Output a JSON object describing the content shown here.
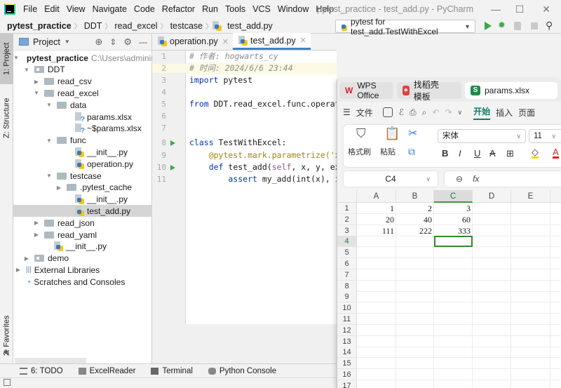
{
  "titlebar": {
    "menu": [
      "File",
      "Edit",
      "View",
      "Navigate",
      "Code",
      "Refactor",
      "Run",
      "Tools",
      "VCS",
      "Window",
      "Help"
    ],
    "window_title": "pytest_practice - test_add.py - PyCharm",
    "minimize": "—",
    "maximize": "☐",
    "close": "✕"
  },
  "navbar": {
    "breadcrumbs": [
      "pytest_practice",
      "DDT",
      "read_excel",
      "testcase",
      "test_add.py"
    ],
    "run_config": "pytest for test_add.TestWithExcel"
  },
  "leftstrip": {
    "project_tab": "1: Project",
    "structure_tab": "Z: Structure",
    "favorites_tab": "2: Favorites"
  },
  "project": {
    "header": "Project",
    "root_path": "C:\\Users\\administe",
    "tree": [
      {
        "label": "pytest_practice",
        "type": "folder",
        "depth": 0,
        "expanded": true
      },
      {
        "label": "DDT",
        "type": "folder",
        "depth": 1,
        "expanded": true
      },
      {
        "label": "read_csv",
        "type": "folder",
        "depth": 2,
        "expanded": false
      },
      {
        "label": "read_excel",
        "type": "folder",
        "depth": 2,
        "expanded": true
      },
      {
        "label": "data",
        "type": "folder",
        "depth": 3,
        "expanded": true
      },
      {
        "label": "params.xlsx",
        "type": "unknown",
        "depth": 4
      },
      {
        "label": "~$params.xlsx",
        "type": "unknown",
        "depth": 4
      },
      {
        "label": "func",
        "type": "folder",
        "depth": 3,
        "expanded": true
      },
      {
        "label": "__init__.py",
        "type": "py",
        "depth": 4
      },
      {
        "label": "operation.py",
        "type": "py",
        "depth": 4
      },
      {
        "label": "testcase",
        "type": "folder",
        "depth": 3,
        "expanded": true
      },
      {
        "label": ".pytest_cache",
        "type": "folder",
        "depth": 4,
        "expanded": false
      },
      {
        "label": "__init__.py",
        "type": "py",
        "depth": 4
      },
      {
        "label": "test_add.py",
        "type": "py",
        "depth": 4,
        "selected": true
      },
      {
        "label": "read_json",
        "type": "folder",
        "depth": 2,
        "expanded": false
      },
      {
        "label": "read_yaml",
        "type": "folder",
        "depth": 2,
        "expanded": false
      },
      {
        "label": "__init__.py",
        "type": "py",
        "depth": 2
      },
      {
        "label": "demo",
        "type": "folder",
        "depth": 1,
        "expanded": false
      },
      {
        "label": "External Libraries",
        "type": "lib",
        "depth": 0,
        "expanded": false
      },
      {
        "label": "Scratches and Consoles",
        "type": "scratch",
        "depth": 0
      }
    ]
  },
  "editor": {
    "tabs": [
      {
        "label": "operation.py",
        "active": false
      },
      {
        "label": "test_add.py",
        "active": true
      }
    ],
    "line_numbers": [
      "1",
      "2",
      "3",
      "4",
      "5",
      "6",
      "7",
      "8",
      "9",
      "10",
      "11"
    ],
    "lines": {
      "l1": "# 作者: hogwarts_cy",
      "l2": "# 时间: 2024/6/6 23:44",
      "l3_kw": "import",
      "l3_rest": " pytest",
      "l5_kw": "from",
      "l5_rest": " DDT.read_excel.func.operat",
      "l8_kw": "class",
      "l8_rest": " TestWithExcel:",
      "l9": "    @pytest.mark.parametrize('x",
      "l10_kw": "    def",
      "l10_name": " test_add(",
      "l10_self": "self",
      "l10_rest": ", x, y, ex",
      "l11_kw": "        assert",
      "l11_rest": " my_add(int(x), i"
    }
  },
  "bottombar": {
    "items": [
      "6: TODO",
      "ExcelReader",
      "Terminal",
      "Python Console"
    ]
  },
  "wps": {
    "tabs": [
      {
        "label": "WPS Office",
        "active": false
      },
      {
        "label": "找稻壳模板",
        "active": false
      },
      {
        "label": "params.xlsx",
        "active": true
      }
    ],
    "menu_file": "文件",
    "menu_tabs": [
      "开始",
      "插入",
      "页面"
    ],
    "ribbon": {
      "format_painter": "格式刷",
      "paste": "粘贴",
      "font_name": "宋体",
      "font_size": "11",
      "bold": "B",
      "italic": "I",
      "underline": "U",
      "strike": "A"
    },
    "name_box": "C4",
    "fx": "fx",
    "columns": [
      "A",
      "B",
      "C",
      "D",
      "E"
    ],
    "rows": [
      "1",
      "2",
      "3",
      "4",
      "5",
      "6",
      "7",
      "8",
      "9",
      "10",
      "11",
      "12",
      "13",
      "14",
      "15",
      "16",
      "17"
    ],
    "selected_cell": "C4",
    "cells": [
      [
        "1",
        "2",
        "3"
      ],
      [
        "20",
        "40",
        "60"
      ],
      [
        "111",
        "222",
        "333"
      ]
    ]
  }
}
